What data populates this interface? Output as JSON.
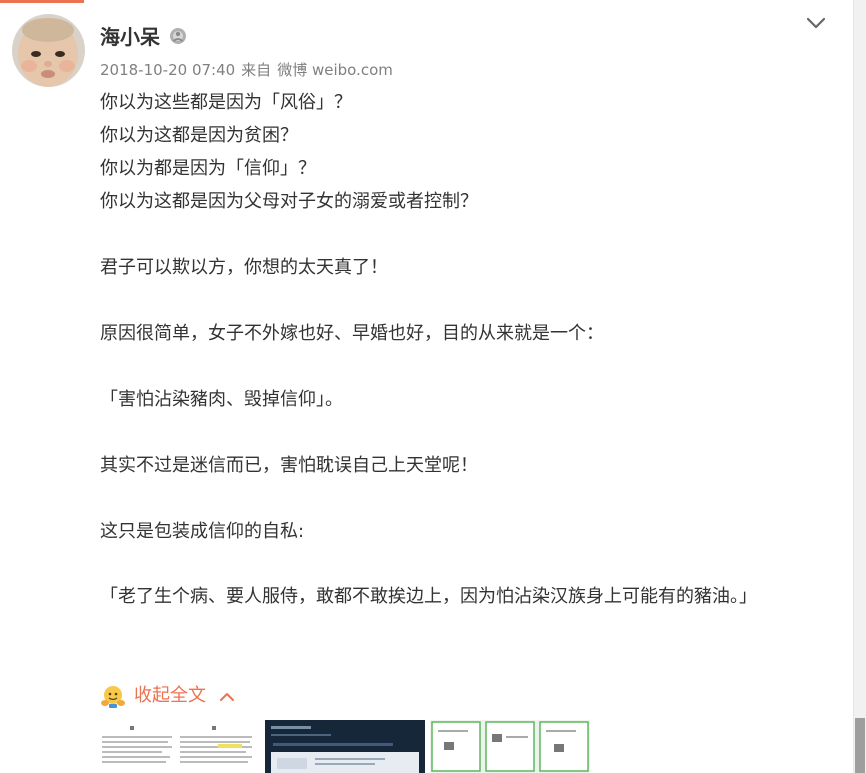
{
  "post": {
    "username": "海小呆",
    "meta": {
      "time": "2018-10-20 07:40",
      "from_label": "来自",
      "source": "微博 weibo.com"
    },
    "lines": [
      "你以为这些都是因为「风俗」？",
      "你以为这都是因为贫困？",
      "你以为都是因为「信仰」？",
      "你以为这都是因为父母对子女的溺爱或者控制？",
      "",
      "君子可以欺以方，你想的太天真了！",
      "",
      "原因很简单，女子不外嫁也好、早婚也好，目的从来就是一个：",
      "",
      "「害怕沾染豬肉、毁掉信仰」。",
      "",
      "其实不过是迷信而已，害怕耽误自己上天堂呢！",
      "",
      "这只是包装成信仰的自私:",
      "",
      "「老了生个病、要人服侍，敢都不敢挨边上，因为怕沾染汉族身上可能有的豬油。」"
    ],
    "collapse_label": "收起全文"
  },
  "colors": {
    "accent": "#eb7350",
    "meta_text": "#808080",
    "body_text": "#333333"
  },
  "icons": {
    "avatar": "baby-avatar",
    "verify": "verified-badge-icon",
    "menu": "chevron-down-icon",
    "collapse_emoji": "smiley-emoji-icon",
    "collapse_arrow": "chevron-up-icon"
  }
}
